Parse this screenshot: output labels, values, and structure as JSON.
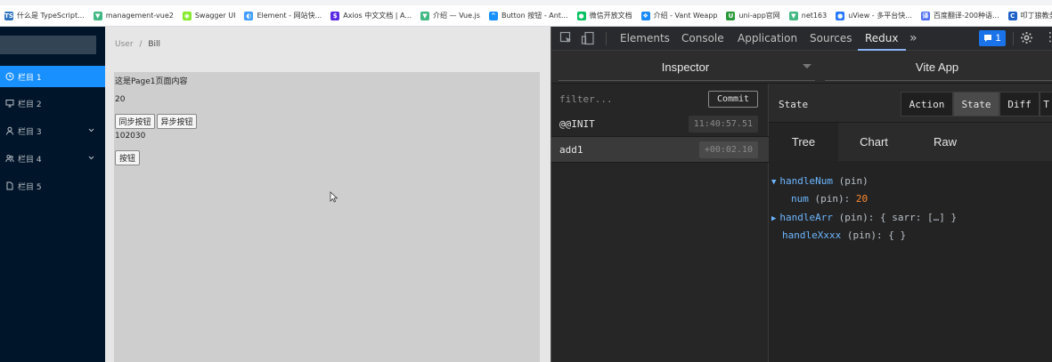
{
  "bookmarks": [
    {
      "label": "什么是 TypeScript...",
      "icon": "ts-icon",
      "color": "#2f74c0",
      "glyph": "TS"
    },
    {
      "label": "management-vue2",
      "icon": "vue-icon",
      "color": "#42b883",
      "glyph": "▼"
    },
    {
      "label": "Swagger UI",
      "icon": "swagger-icon",
      "color": "#85ea2d",
      "glyph": "◉"
    },
    {
      "label": "Element - 网站快...",
      "icon": "element-icon",
      "color": "#409eff",
      "glyph": "◐"
    },
    {
      "label": "Axios 中文文档 | A...",
      "icon": "axios-icon",
      "color": "#5a29e4",
      "glyph": "$"
    },
    {
      "label": "介绍 — Vue.js",
      "icon": "vue-icon",
      "color": "#42b883",
      "glyph": "▼"
    },
    {
      "label": "Button 按钮 - Ant...",
      "icon": "antd-icon",
      "color": "#1890ff",
      "glyph": "^"
    },
    {
      "label": "微信开放文档",
      "icon": "wechat-icon",
      "color": "#07c160",
      "glyph": "●"
    },
    {
      "label": "介绍 - Vant Weapp",
      "icon": "vant-icon",
      "color": "#1989fa",
      "glyph": "❖"
    },
    {
      "label": "uni-app官网",
      "icon": "uniapp-icon",
      "color": "#2b9939",
      "glyph": "U"
    },
    {
      "label": "net163",
      "icon": "vue-icon",
      "color": "#42b883",
      "glyph": "▼"
    },
    {
      "label": "uView - 多平台快...",
      "icon": "uview-icon",
      "color": "#2979ff",
      "glyph": "●"
    },
    {
      "label": "百度翻译-200种语...",
      "icon": "baidu-translate-icon",
      "color": "#4e6ef2",
      "glyph": "译"
    },
    {
      "label": "叩丁狼教务管理系统",
      "icon": "edu-icon",
      "color": "#1e62c8",
      "glyph": "C"
    }
  ],
  "sidebar": {
    "items": [
      {
        "label": "栏目 1",
        "icon": "clock-icon",
        "active": true,
        "submenu": false
      },
      {
        "label": "栏目 2",
        "icon": "desktop-icon",
        "active": false,
        "submenu": false
      },
      {
        "label": "栏目 3",
        "icon": "user-icon",
        "active": false,
        "submenu": true
      },
      {
        "label": "栏目 4",
        "icon": "team-icon",
        "active": false,
        "submenu": true
      },
      {
        "label": "栏目 5",
        "icon": "file-icon",
        "active": false,
        "submenu": false
      }
    ]
  },
  "breadcrumb": {
    "parent": "User",
    "separator": "/",
    "current": "Bill"
  },
  "page": {
    "intro": "这是Page1页面内容",
    "num": "20",
    "sync_button": "同步按钮",
    "async_button": "异步按钮",
    "arr_text": "102030",
    "button": "按钮"
  },
  "devtools": {
    "tabs": [
      "Elements",
      "Console",
      "Application",
      "Sources",
      "Redux"
    ],
    "active_tab": "Redux",
    "more": "»",
    "badge_count": "1",
    "inspector_label": "Inspector",
    "app_label": "Vite App",
    "filter_placeholder": "filter...",
    "commit_label": "Commit",
    "actions": [
      {
        "name": "@@INIT",
        "time": "11:40:57.51",
        "selected": false
      },
      {
        "name": "add1",
        "time": "+00:02.10",
        "selected": true
      }
    ],
    "state_title": "State",
    "mode_buttons": [
      "Action",
      "State",
      "Diff",
      "T"
    ],
    "active_mode": "State",
    "view_tabs": [
      "Tree",
      "Chart",
      "Raw"
    ],
    "active_view": "Tree",
    "tree": {
      "handleNum": {
        "key": "handleNum",
        "suffix": "(pin)"
      },
      "num": {
        "key": "num",
        "suffix": "(pin):",
        "value": "20"
      },
      "handleArr": {
        "key": "handleArr",
        "suffix": "(pin):",
        "value": "{ sarr: […] }"
      },
      "handleXxxx": {
        "key": "handleXxxx",
        "suffix": "(pin):",
        "value": "{ }"
      }
    },
    "colors": {
      "accent": "#1890ff",
      "devtools_bg": "#242424",
      "tree_key": "#6cb6ff",
      "tree_number": "#ff8a30"
    }
  }
}
